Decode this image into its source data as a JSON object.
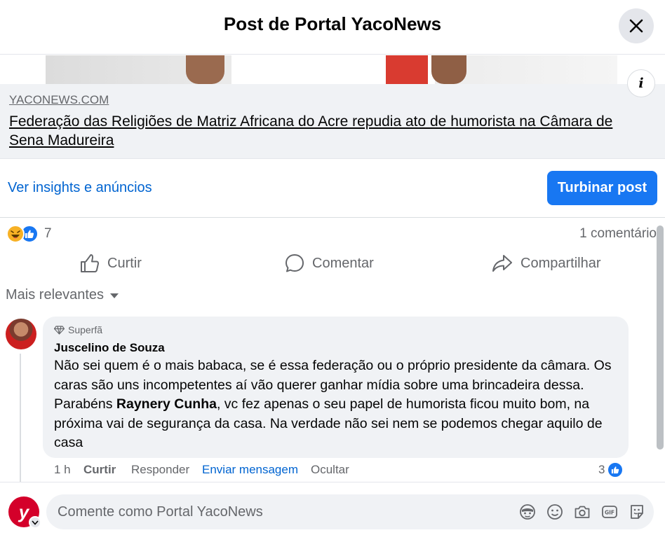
{
  "header": {
    "title": "Post de Portal YacoNews"
  },
  "link_preview": {
    "domain": "YACONEWS.COM",
    "title": "Federação das Religiões de Matriz Africana do Acre repudia ato de humorista na Câmara de Sena Madureira"
  },
  "info_icon": "i",
  "insights": {
    "link_label": "Ver insights e anúncios",
    "boost_label": "Turbinar post"
  },
  "reactions": {
    "count": "7",
    "types": [
      "haha-icon",
      "like-icon"
    ]
  },
  "comments_count": "1 comentário",
  "actions": {
    "like": "Curtir",
    "comment": "Comentar",
    "share": "Compartilhar"
  },
  "sort": {
    "label": "Mais relevantes"
  },
  "comment": {
    "badge": "Superfã",
    "author": "Juscelino de Souza",
    "text_before": "Não sei quem é o mais babaca, se é essa federação ou o próprio presidente da câmara. Os caras são uns incompetentes aí vão querer ganhar mídia sobre uma brincadeira dessa. Parabéns ",
    "mention": "Raynery Cunha",
    "text_after": ", vc fez apenas o seu papel de humorista ficou muito bom, na próxima vai de segurança da casa. Na verdade não sei nem se podemos chegar aquilo de casa",
    "time": "1 h",
    "like": "Curtir",
    "reply": "Responder",
    "message": "Enviar mensagem",
    "hide": "Ocultar",
    "like_count": "3"
  },
  "composer": {
    "placeholder": "Comente como Portal YacoNews",
    "avatar_letter": "y",
    "icons": [
      "avatar-sticker-icon",
      "emoji-icon",
      "camera-icon",
      "gif-icon",
      "sticker-icon"
    ]
  },
  "colors": {
    "accent": "#1877f2",
    "link": "#0064d1",
    "secondary_text": "#65676b",
    "surface": "#f0f2f5"
  }
}
